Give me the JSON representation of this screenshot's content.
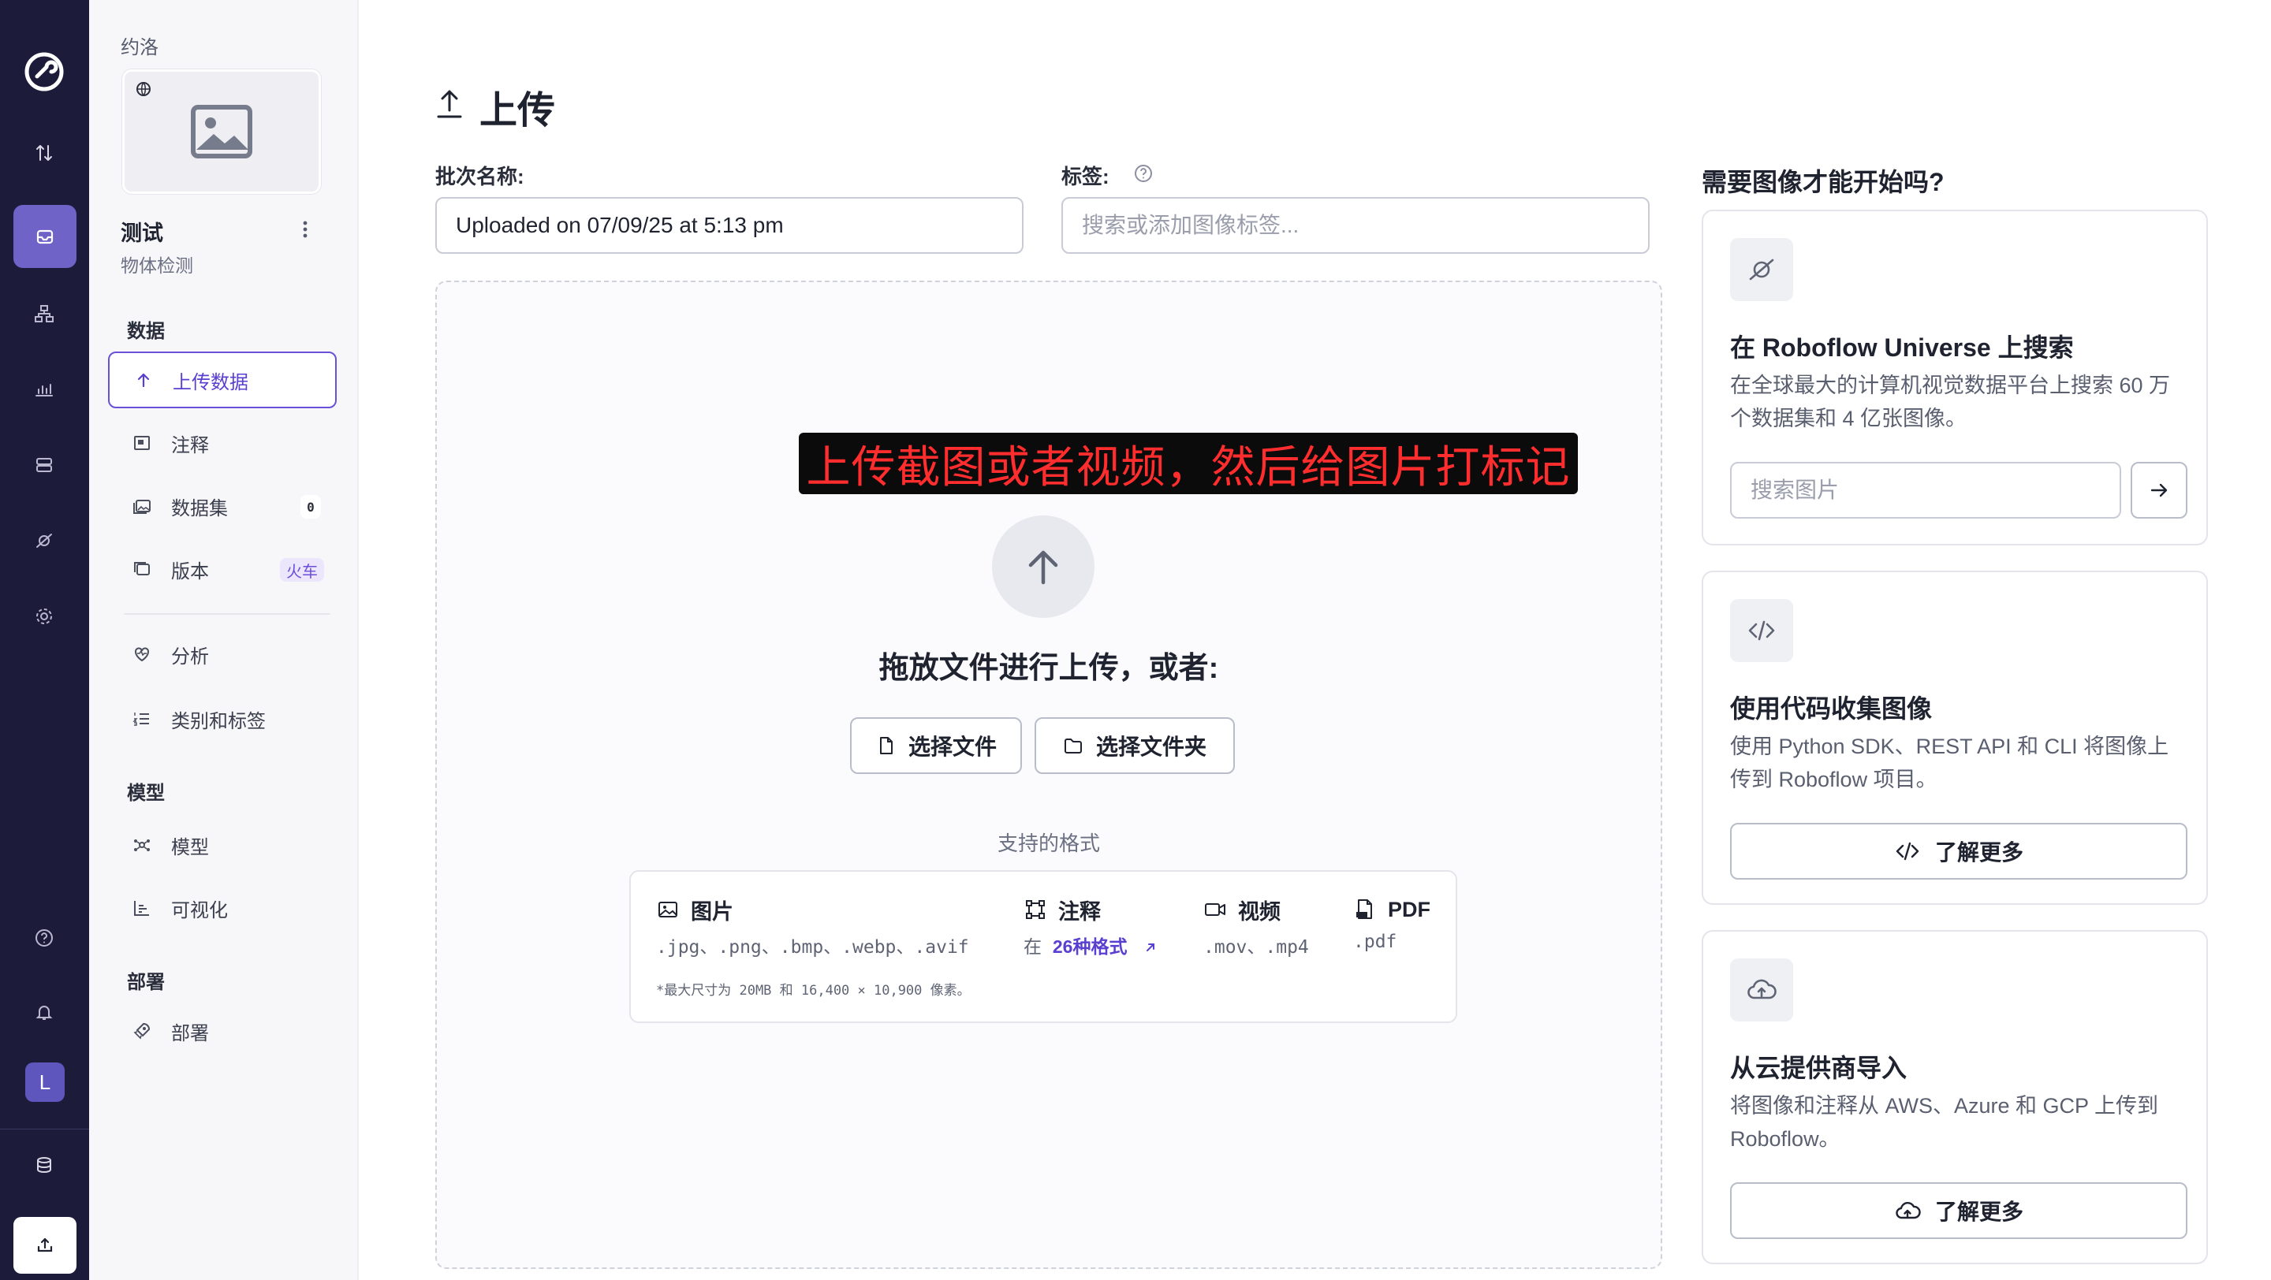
{
  "workspace": {
    "name": "约洛"
  },
  "project": {
    "name": "测试",
    "type": "物体检测"
  },
  "sidebar": {
    "sections": {
      "data": "数据",
      "models": "模型",
      "deploy": "部署"
    },
    "items": {
      "upload": "上传数据",
      "annotate": "注释",
      "dataset": "数据集",
      "dataset_count": "0",
      "versions": "版本",
      "versions_badge": "火车",
      "analytics": "分析",
      "classes": "类别和标签",
      "models": "模型",
      "visualize": "可视化",
      "deploy": "部署"
    }
  },
  "rail": {
    "avatar_letter": "L"
  },
  "page": {
    "title": "上传"
  },
  "batch": {
    "label": "批次名称:",
    "value": "Uploaded on 07/09/25 at 5:13 pm"
  },
  "tags": {
    "label": "标签:",
    "placeholder": "搜索或添加图像标签..."
  },
  "dropzone": {
    "overlay_text": "上传截图或者视频，然后给图片打标记",
    "drop_text": "拖放文件进行上传，或者:",
    "select_files": "选择文件",
    "select_folder": "选择文件夹",
    "formats_caption": "支持的格式",
    "formats": {
      "images_title": "图片",
      "images_exts": ".jpg、.png、.bmp、.webp、.avif",
      "annotations_title": "注释",
      "annotations_prefix": "在",
      "annotations_link": "26种格式",
      "video_title": "视频",
      "video_exts": ".mov、.mp4",
      "pdf_title": "PDF",
      "pdf_exts": ".pdf",
      "note": "*最大尺寸为 20MB 和 16,400 × 10,900 像素。"
    }
  },
  "right_panel": {
    "title": "需要图像才能开始吗?",
    "universe": {
      "title": "在 Roboflow Universe 上搜索",
      "desc": "在全球最大的计算机视觉数据平台上搜索 60 万个数据集和 4 亿张图像。",
      "search_placeholder": "搜索图片"
    },
    "code": {
      "title": "使用代码收集图像",
      "desc": "使用 Python SDK、REST API 和 CLI 将图像上传到 Roboflow 项目。",
      "button": "了解更多"
    },
    "cloud": {
      "title": "从云提供商导入",
      "desc": "将图像和注释从 AWS、Azure 和 GCP 上传到 Roboflow。",
      "button": "了解更多"
    }
  },
  "colors": {
    "rail_bg": "#1d1b3a",
    "accent": "#6a50d8",
    "overlay_text": "#ff2d2d"
  }
}
